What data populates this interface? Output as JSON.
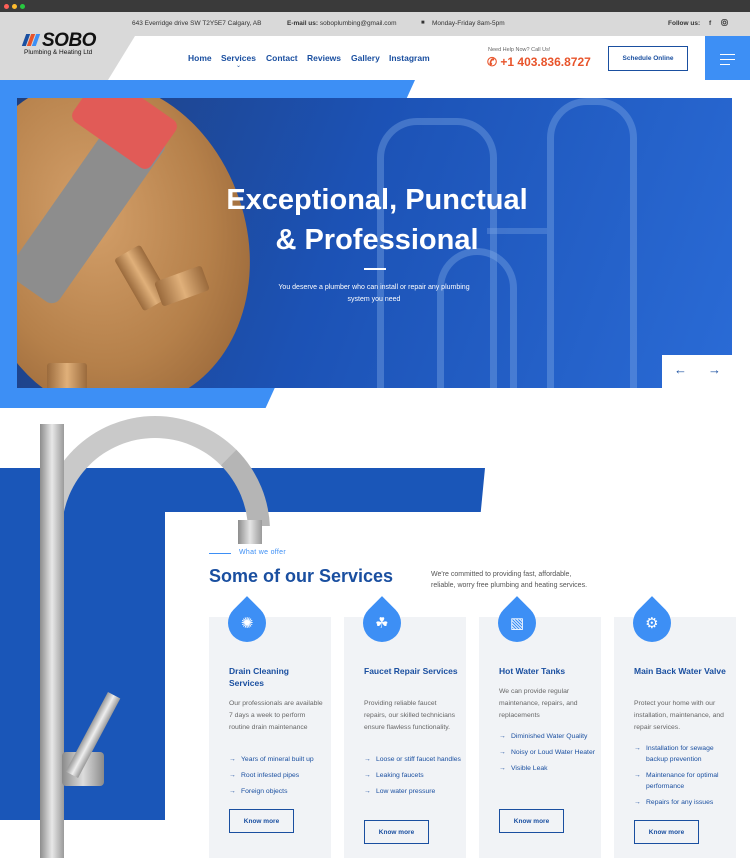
{
  "topbar": {
    "address": "643 Everridge drive SW T2Y5E7 Calgary, AB",
    "email_label": "E-mail us:",
    "email": "soboplumbing@gmail.com",
    "hours": "Monday-Friday 8am-5pm",
    "follow_label": "Follow us:",
    "social_icons": [
      "facebook-icon",
      "instagram-icon"
    ]
  },
  "logo": {
    "name": "SOBO",
    "tagline": "Plumbing & Heating Ltd",
    "stripe_colors": [
      "#1a4fa0",
      "#e8542b",
      "#3d8ff5"
    ]
  },
  "nav": {
    "items": [
      "Home",
      "Services",
      "Contact",
      "Reviews",
      "Gallery",
      "Instagram"
    ]
  },
  "header": {
    "help_text": "Need Help Now? Call Us!",
    "phone": "+1 403.836.8727",
    "schedule_label": "Schedule Online"
  },
  "hero": {
    "title_line1": "Exceptional, Punctual",
    "title_line2": "& Professional",
    "subtitle_line1": "You deserve a plumber who can install or repair any plumbing",
    "subtitle_line2": "system you need",
    "prev_arrow": "←",
    "next_arrow": "→"
  },
  "services": {
    "eyebrow": "What we offer",
    "title": "Some of our Services",
    "description_line1": "We're committed to providing fast, affordable,",
    "description_line2": "reliable, worry free plumbing and heating services.",
    "cards": [
      {
        "icon": "drain-icon",
        "title": "Drain Cleaning Services",
        "text": "Our professionals are available 7 days a week to perform routine drain maintenance",
        "items": [
          "Years of mineral built up",
          "Root infested pipes",
          "Foreign objects"
        ],
        "button": "Know more"
      },
      {
        "icon": "faucet-icon",
        "title": "Faucet Repair Services",
        "text": "Providing reliable faucet repairs, our skilled technicians ensure flawless functionality.",
        "items": [
          "Loose or stiff faucet handles",
          "Leaking faucets",
          "Low water pressure"
        ],
        "button": "Know more"
      },
      {
        "icon": "water-heater-icon",
        "title": "Hot Water Tanks",
        "text": "We can provide regular maintenance, repairs, and replacements",
        "items": [
          "Diminished Water Quality",
          "Noisy or Loud Water Heater",
          "Visible Leak"
        ],
        "button": "Know more"
      },
      {
        "icon": "valve-icon",
        "title": "Main Back Water Valve",
        "text": "Protect your home with our installation, maintenance, and repair services.",
        "items": [
          "Installation for sewage backup prevention",
          "Maintenance for optimal performance",
          "Repairs for any issues"
        ],
        "button": "Know more"
      }
    ]
  },
  "colors": {
    "brand_blue": "#1a4fa0",
    "accent_blue": "#3d8ff5",
    "accent_orange": "#e8542b"
  }
}
